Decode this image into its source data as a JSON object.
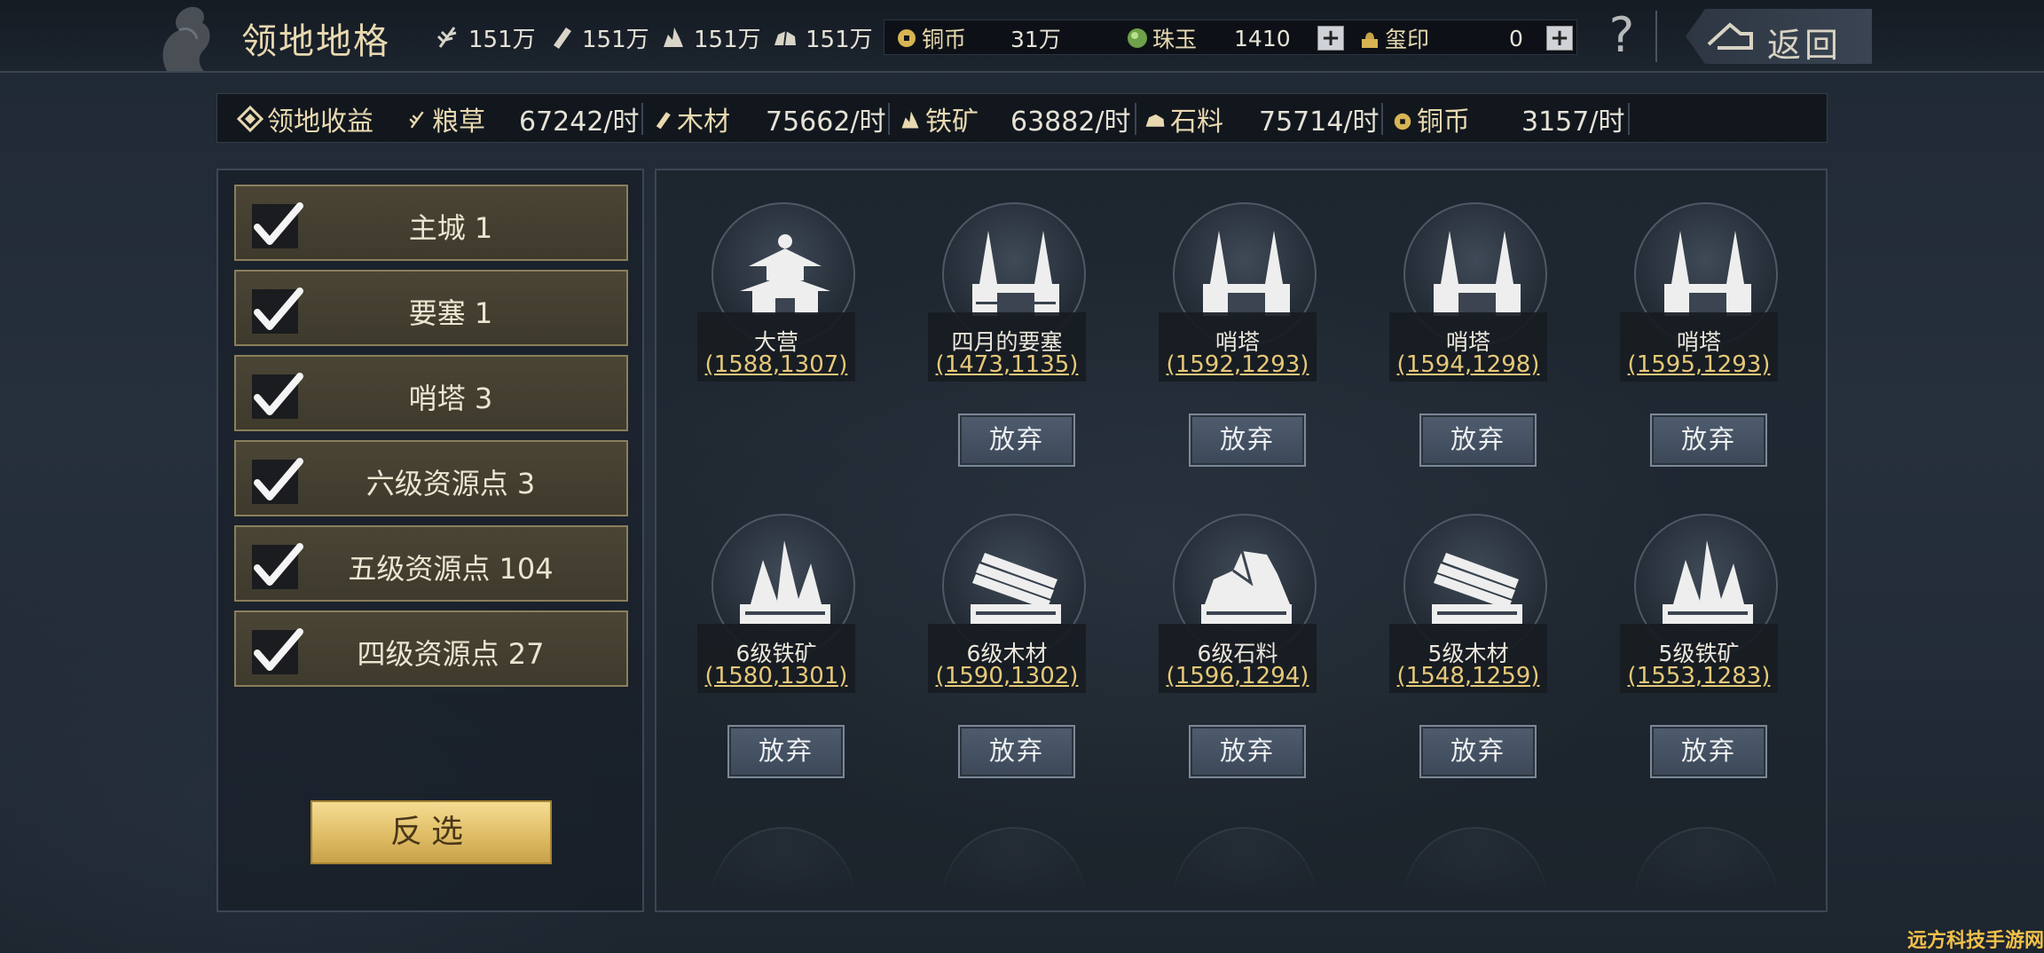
{
  "header": {
    "title": "领地地格",
    "back_label": "返回",
    "help_label": "?",
    "resources": [
      {
        "icon": "grain-icon",
        "value": "151万"
      },
      {
        "icon": "wood-icon",
        "value": "151万"
      },
      {
        "icon": "iron-icon",
        "value": "151万"
      },
      {
        "icon": "stone-icon",
        "value": "151万"
      }
    ],
    "wallet": {
      "copper_label": "铜币",
      "copper_value": "31万",
      "jade_label": "珠玉",
      "jade_value": "1410",
      "seal_label": "玺印",
      "seal_value": "0",
      "plus": "+"
    }
  },
  "income": {
    "title": "领地收益",
    "items": [
      {
        "label": "粮草",
        "value": "67242/时",
        "icon": "grain-icon"
      },
      {
        "label": "木材",
        "value": "75662/时",
        "icon": "wood-icon"
      },
      {
        "label": "铁矿",
        "value": "63882/时",
        "icon": "iron-icon"
      },
      {
        "label": "石料",
        "value": "75714/时",
        "icon": "stone-icon"
      },
      {
        "label": "铜币",
        "value": "3157/时",
        "icon": "coin-icon"
      }
    ]
  },
  "filters": [
    {
      "label": "主城 1",
      "checked": true
    },
    {
      "label": "要塞 1",
      "checked": true
    },
    {
      "label": "哨塔 3",
      "checked": true
    },
    {
      "label": "六级资源点 3",
      "checked": true
    },
    {
      "label": "五级资源点 104",
      "checked": true
    },
    {
      "label": "四级资源点 27",
      "checked": true
    }
  ],
  "invert_label": "反选",
  "tiles": [
    {
      "name": "大营",
      "coord": "(1588,1307)",
      "icon": "camp-icon",
      "abandon": ""
    },
    {
      "name": "四月的要塞",
      "coord": "(1473,1135)",
      "icon": "fortress-icon",
      "abandon": "放弃"
    },
    {
      "name": "哨塔",
      "coord": "(1592,1293)",
      "icon": "watchtower-icon",
      "abandon": "放弃"
    },
    {
      "name": "哨塔",
      "coord": "(1594,1298)",
      "icon": "watchtower-icon",
      "abandon": "放弃"
    },
    {
      "name": "哨塔",
      "coord": "(1595,1293)",
      "icon": "watchtower-icon",
      "abandon": "放弃"
    },
    {
      "name": "6级铁矿",
      "coord": "(1580,1301)",
      "icon": "iron-ore-icon",
      "abandon": "放弃"
    },
    {
      "name": "6级木材",
      "coord": "(1590,1302)",
      "icon": "lumber-icon",
      "abandon": "放弃"
    },
    {
      "name": "6级石料",
      "coord": "(1596,1294)",
      "icon": "stone-quarry-icon",
      "abandon": "放弃"
    },
    {
      "name": "5级木材",
      "coord": "(1548,1259)",
      "icon": "lumber-icon",
      "abandon": "放弃"
    },
    {
      "name": "5级铁矿",
      "coord": "(1553,1283)",
      "icon": "iron-ore-icon",
      "abandon": "放弃"
    }
  ],
  "watermark": "远方科技手游网"
}
